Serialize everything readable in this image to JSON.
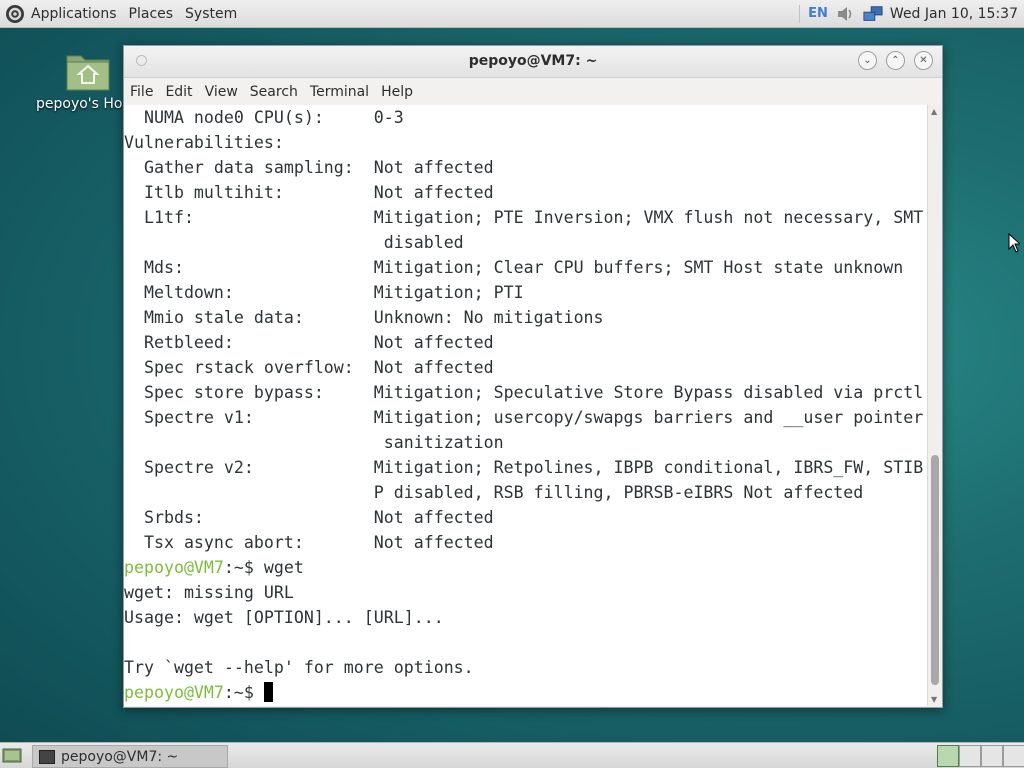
{
  "top_panel": {
    "menu": [
      "Applications",
      "Places",
      "System"
    ],
    "language": "EN",
    "clock": "Wed Jan 10, 15:37"
  },
  "desktop": {
    "home_icon_label": "pepoyo's Hon"
  },
  "window": {
    "title": "pepoyo@VM7: ~",
    "menu": [
      "File",
      "Edit",
      "View",
      "Search",
      "Terminal",
      "Help"
    ]
  },
  "terminal": {
    "lines": [
      "  NUMA node0 CPU(s):     0-3",
      "Vulnerabilities:",
      "  Gather data sampling:  Not affected",
      "  Itlb multihit:         Not affected",
      "  L1tf:                  Mitigation; PTE Inversion; VMX flush not necessary, SMT",
      "                          disabled",
      "  Mds:                   Mitigation; Clear CPU buffers; SMT Host state unknown",
      "  Meltdown:              Mitigation; PTI",
      "  Mmio stale data:       Unknown: No mitigations",
      "  Retbleed:              Not affected",
      "  Spec rstack overflow:  Not affected",
      "  Spec store bypass:     Mitigation; Speculative Store Bypass disabled via prctl",
      "  Spectre v1:            Mitigation; usercopy/swapgs barriers and __user pointer",
      "                          sanitization",
      "  Spectre v2:            Mitigation; Retpolines, IBPB conditional, IBRS_FW, STIB",
      "                         P disabled, RSB filling, PBRSB-eIBRS Not affected",
      "  Srbds:                 Not affected",
      "  Tsx async abort:       Not affected"
    ],
    "prompt_user": "pepoyo@VM7",
    "prompt_suffix": ":~$ ",
    "command": "wget",
    "output": [
      "wget: missing URL",
      "Usage: wget [OPTION]... [URL]...",
      "",
      "Try `wget --help' for more options."
    ]
  },
  "taskbar": {
    "task_label": "pepoyo@VM7: ~"
  }
}
